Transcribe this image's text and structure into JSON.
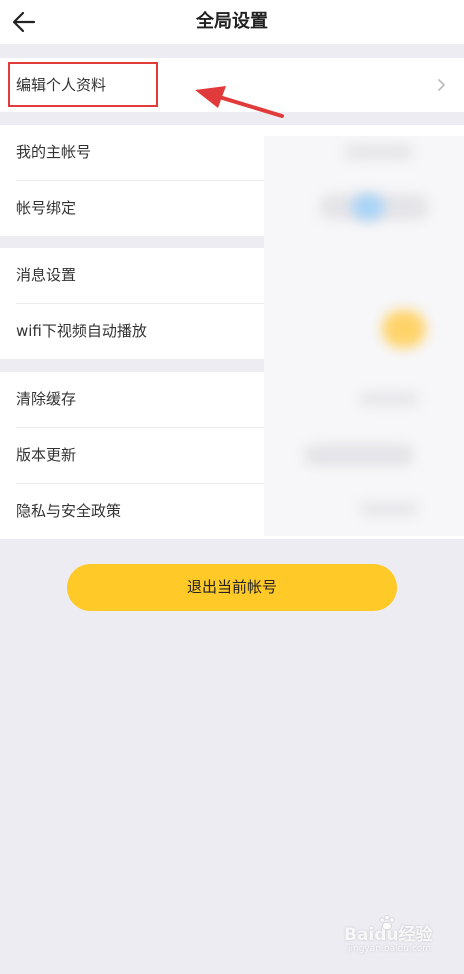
{
  "header": {
    "title": "全局设置",
    "back_icon": "arrow-left-icon"
  },
  "groups": [
    {
      "items": [
        {
          "label": "编辑个人资料",
          "icon": "chevron-right-icon"
        }
      ]
    },
    {
      "items": [
        {
          "label": "我的主帐号"
        },
        {
          "label": "帐号绑定"
        }
      ]
    },
    {
      "items": [
        {
          "label": "消息设置"
        },
        {
          "label": "wifi下视频自动播放"
        }
      ]
    },
    {
      "items": [
        {
          "label": "清除缓存"
        },
        {
          "label": "版本更新"
        },
        {
          "label": "隐私与安全政策"
        }
      ]
    }
  ],
  "logout_button": {
    "label": "退出当前帐号"
  },
  "watermark": {
    "main": "Baidu经验",
    "sub": "jingyan.baidu.com"
  },
  "colors": {
    "background": "#edecf2",
    "accent_yellow": "#ffc928",
    "annotation_red": "#e03a3a"
  }
}
